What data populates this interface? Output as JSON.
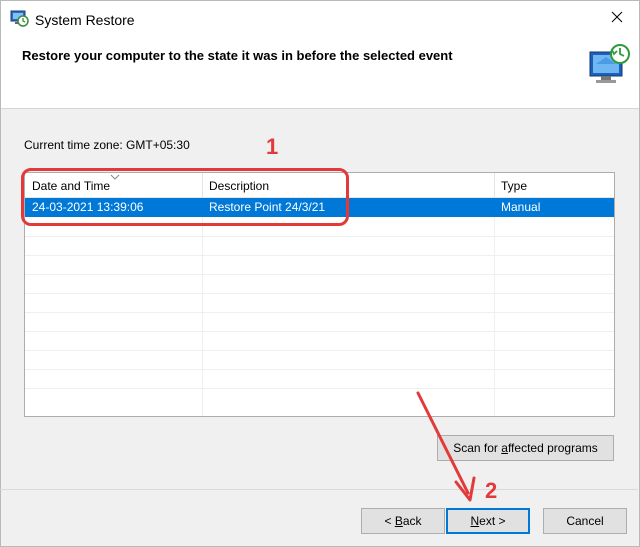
{
  "window": {
    "title": "System Restore",
    "header_text": "Restore your computer to the state it was in before the selected event"
  },
  "timezone": {
    "label": "Current time zone: GMT+05:30"
  },
  "table": {
    "columns": [
      "Date and Time",
      "Description",
      "Type"
    ],
    "rows": [
      {
        "date_time": "24-03-2021 13:39:06",
        "description": "Restore Point 24/3/21",
        "type": "Manual",
        "selected": true
      }
    ]
  },
  "buttons": {
    "scan_prefix": "Scan for ",
    "scan_access": "a",
    "scan_suffix": "ffected programs",
    "back_prefix": "< ",
    "back_access": "B",
    "back_suffix": "ack",
    "next_access": "N",
    "next_suffix": "ext >",
    "cancel": "Cancel"
  },
  "annotations": {
    "label_1": "1",
    "label_2": "2"
  },
  "colors": {
    "selection": "#0078d7",
    "annotation": "#e23a3a"
  },
  "icons": {
    "title": "system-restore-icon",
    "header": "monitor-restore-icon",
    "close": "close-icon"
  }
}
